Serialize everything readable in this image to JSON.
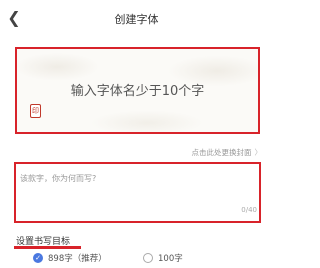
{
  "header": {
    "back_icon": "chevron-left-icon",
    "title": "创建字体"
  },
  "cover": {
    "placeholder": "输入字体名少于10个字",
    "seal_text": "印"
  },
  "change_cover": {
    "label": "点击此处更换封面",
    "chevron": "〉"
  },
  "description": {
    "placeholder": "该款字，你为何而写?",
    "counter": "0/40"
  },
  "goal": {
    "label": "设置书写目标",
    "options": [
      {
        "label": "898字（推荐）",
        "selected": true
      },
      {
        "label": "100字",
        "selected": false
      }
    ]
  },
  "colors": {
    "highlight_red": "#d8232a",
    "radio_blue": "#4a78e0"
  }
}
